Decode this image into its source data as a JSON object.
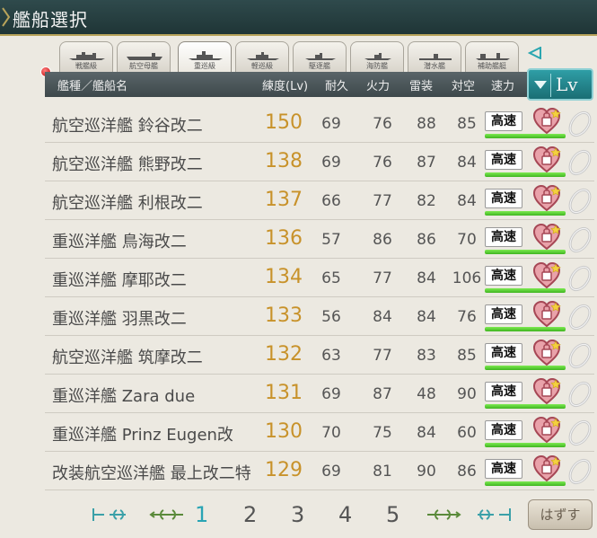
{
  "window": {
    "title": "艦船選択"
  },
  "tabs": [
    {
      "label": "戦艦級"
    },
    {
      "label": "航空母艦"
    },
    {
      "label": "重巡級"
    },
    {
      "label": "軽巡級"
    },
    {
      "label": "駆逐艦"
    },
    {
      "label": "海防艦"
    },
    {
      "label": "潜水艦"
    },
    {
      "label": "補助艦艇"
    }
  ],
  "active_tab": "重巡級",
  "header": {
    "type_name": "艦種／艦船名",
    "level": "練度(Lv)",
    "hp": "耐久",
    "firepower": "火力",
    "torpedo": "雷装",
    "aa": "対空",
    "speed": "速力"
  },
  "sort": {
    "label": "Lv"
  },
  "ships": [
    {
      "name": "航空巡洋艦 鈴谷改二",
      "lv": "150",
      "hp": "69",
      "fp": "76",
      "tp": "88",
      "aa": "85",
      "speed": "高速"
    },
    {
      "name": "航空巡洋艦 熊野改二",
      "lv": "138",
      "hp": "69",
      "fp": "76",
      "tp": "87",
      "aa": "84",
      "speed": "高速"
    },
    {
      "name": "航空巡洋艦 利根改二",
      "lv": "137",
      "hp": "66",
      "fp": "77",
      "tp": "82",
      "aa": "84",
      "speed": "高速"
    },
    {
      "name": "重巡洋艦 鳥海改二",
      "lv": "136",
      "hp": "57",
      "fp": "86",
      "tp": "86",
      "aa": "70",
      "speed": "高速"
    },
    {
      "name": "重巡洋艦 摩耶改二",
      "lv": "134",
      "hp": "65",
      "fp": "77",
      "tp": "84",
      "aa": "106",
      "speed": "高速"
    },
    {
      "name": "重巡洋艦 羽黒改二",
      "lv": "133",
      "hp": "56",
      "fp": "84",
      "tp": "84",
      "aa": "76",
      "speed": "高速"
    },
    {
      "name": "航空巡洋艦 筑摩改二",
      "lv": "132",
      "hp": "63",
      "fp": "77",
      "tp": "83",
      "aa": "85",
      "speed": "高速"
    },
    {
      "name": "重巡洋艦 Zara due",
      "lv": "131",
      "hp": "69",
      "fp": "87",
      "tp": "48",
      "aa": "90",
      "speed": "高速"
    },
    {
      "name": "重巡洋艦 Prinz Eugen改",
      "lv": "130",
      "hp": "70",
      "fp": "75",
      "tp": "84",
      "aa": "60",
      "speed": "高速"
    },
    {
      "name": "改装航空巡洋艦 最上改二特",
      "lv": "129",
      "hp": "69",
      "fp": "81",
      "tp": "90",
      "aa": "86",
      "speed": "高速"
    }
  ],
  "pager": {
    "pages": [
      "1",
      "2",
      "3",
      "4",
      "5"
    ],
    "current": "1"
  },
  "remove_button": {
    "label": "はずす"
  },
  "colors": {
    "level": "#c8922a",
    "page_current": "#29a4b4",
    "bar": "#3fb520",
    "header": "#4a5558"
  },
  "icons": [
    "first-page-icon",
    "prev-page-icon",
    "next-page-icon",
    "last-page-icon",
    "heart-lock-icon",
    "ring-icon",
    "ship-silhouette-icon"
  ]
}
